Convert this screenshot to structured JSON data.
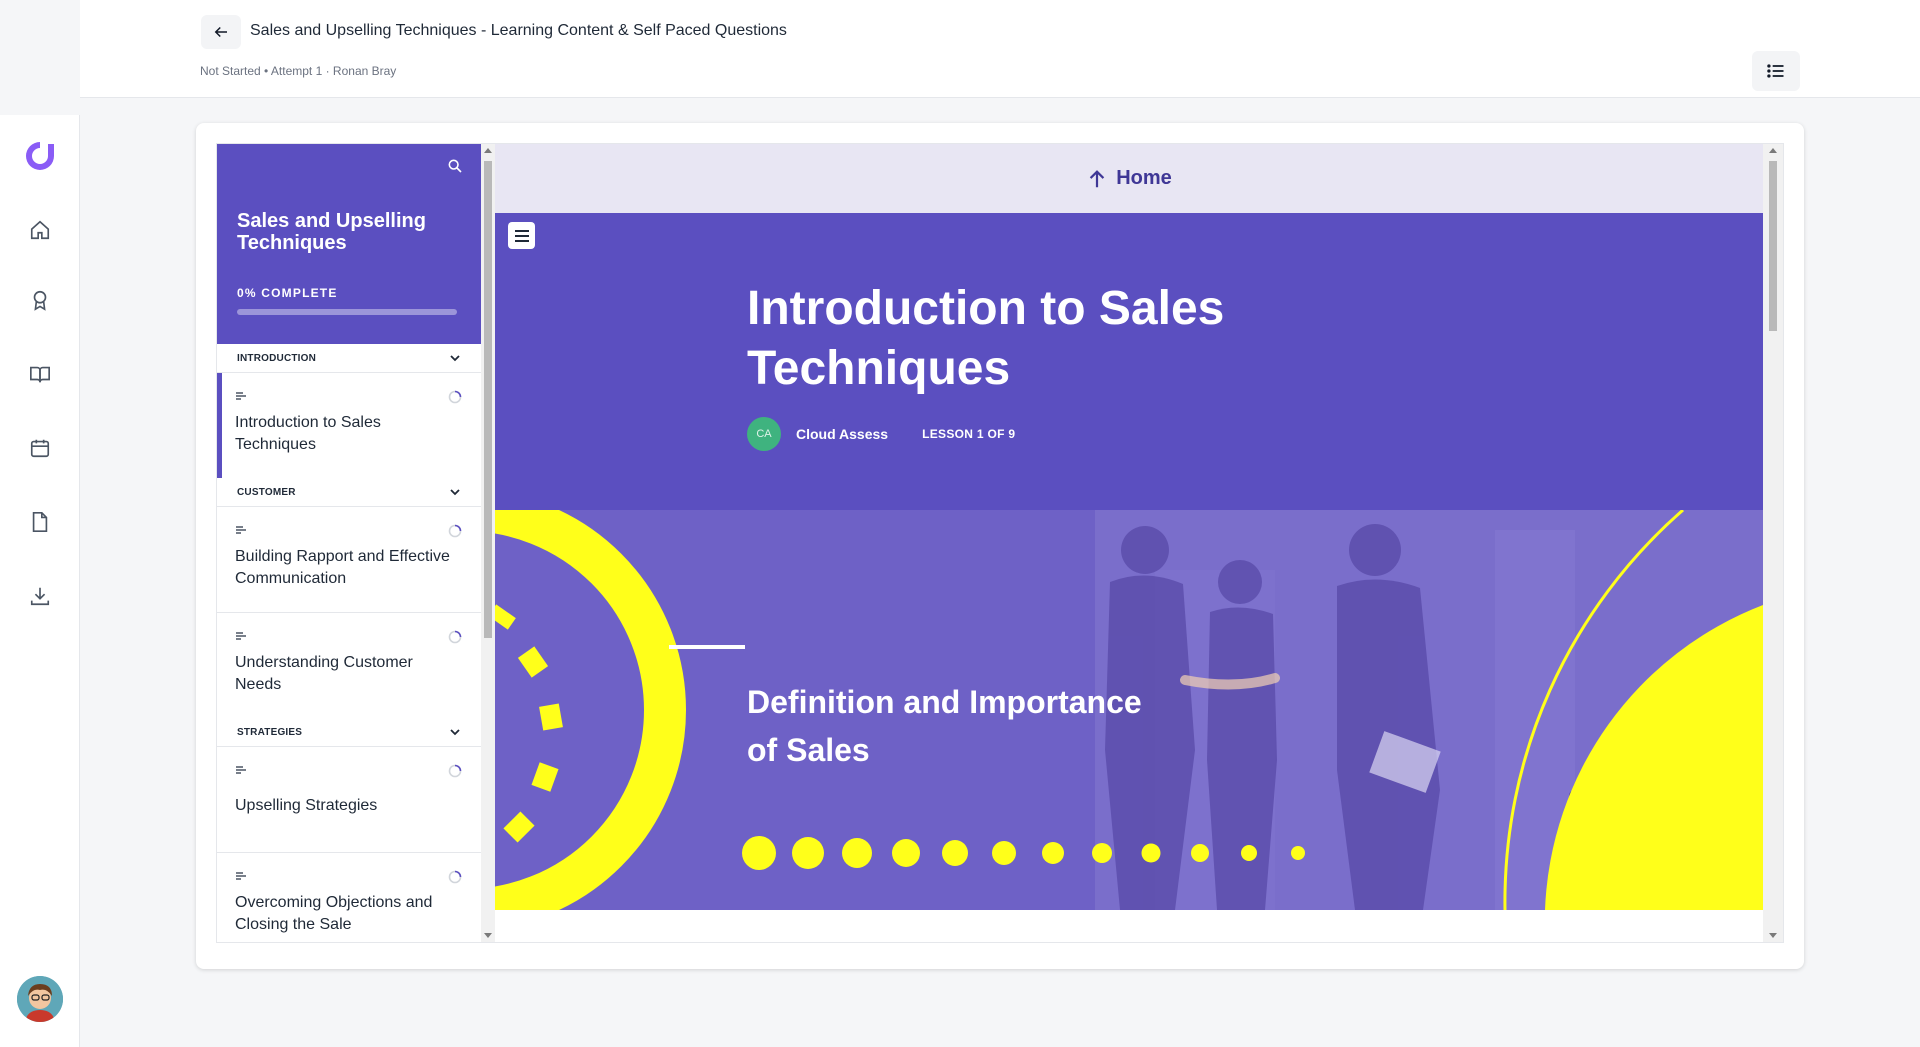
{
  "header": {
    "title": "Sales and Upselling Techniques - Learning Content & Self Paced Questions",
    "meta": "Not Started • Attempt 1 · Ronan Bray"
  },
  "rail": {
    "icons": [
      "home-icon",
      "award-icon",
      "book-icon",
      "calendar-icon",
      "document-icon",
      "download-icon"
    ]
  },
  "course": {
    "title": "Sales and Upselling Techniques",
    "progress_label": "0% COMPLETE",
    "progress": 0,
    "sections": [
      {
        "label": "INTRODUCTION",
        "lessons": [
          "Introduction to Sales Techniques"
        ]
      },
      {
        "label": "CUSTOMER",
        "lessons": [
          "Building Rapport and Effective Communication",
          "Understanding Customer Needs"
        ]
      },
      {
        "label": "STRATEGIES",
        "lessons": [
          "Upselling Strategies",
          "Overcoming Objections and Closing the Sale"
        ]
      }
    ]
  },
  "lesson": {
    "home_label": "Home",
    "title": "Introduction to Sales Techniques",
    "author_initials": "CA",
    "author": "Cloud Assess",
    "count": "LESSON 1 OF 9",
    "banner_title": "Definition and Importance of Sales"
  },
  "colors": {
    "brand": "#5b4fc0",
    "accent_yellow": "#ffff1a",
    "banner": "#6e61c6"
  }
}
